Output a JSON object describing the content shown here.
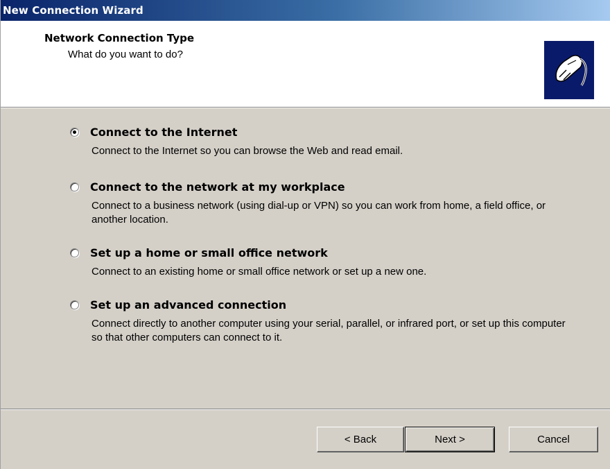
{
  "window": {
    "title": "New Connection Wizard"
  },
  "header": {
    "title": "Network Connection Type",
    "subtitle": "What do you want to do?",
    "icon": "network-cable-icon"
  },
  "options": [
    {
      "label": "Connect to the Internet",
      "description": "Connect to the Internet so you can browse the Web and read email.",
      "selected": true
    },
    {
      "label": "Connect to the network at my workplace",
      "description": "Connect to a business network (using dial-up or VPN) so you can work from home, a field office, or another location.",
      "selected": false
    },
    {
      "label": "Set up a home or small office network",
      "description": "Connect to an existing home or small office network or set up a new one.",
      "selected": false
    },
    {
      "label": "Set up an advanced connection",
      "description": "Connect directly to another computer using your serial, parallel, or infrared port, or set up this computer so that other computers can connect to it.",
      "selected": false
    }
  ],
  "buttons": {
    "back": "< Back",
    "next": "Next >",
    "cancel": "Cancel"
  },
  "colors": {
    "titlebar_start": "#0a246a",
    "titlebar_end": "#a6caf0",
    "dialog_bg": "#d4d0c8",
    "icon_bg": "#0a1a6a"
  }
}
